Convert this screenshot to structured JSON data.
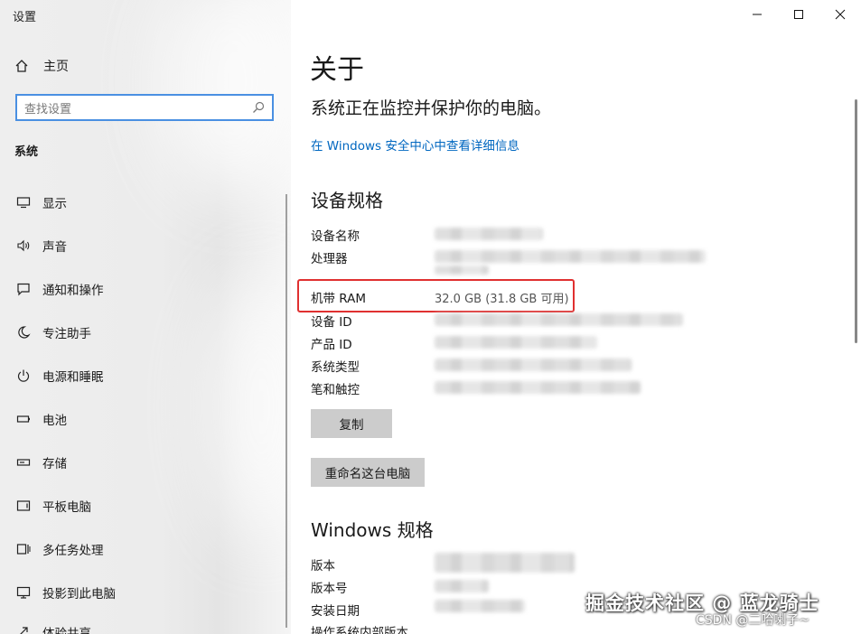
{
  "window": {
    "title": "设置"
  },
  "sidebar": {
    "home_label": "主页",
    "search_placeholder": "查找设置",
    "section_label": "系统",
    "items": [
      {
        "label": "显示",
        "icon": "monitor-icon"
      },
      {
        "label": "声音",
        "icon": "speaker-icon"
      },
      {
        "label": "通知和操作",
        "icon": "notification-icon"
      },
      {
        "label": "专注助手",
        "icon": "moon-icon"
      },
      {
        "label": "电源和睡眠",
        "icon": "power-icon"
      },
      {
        "label": "电池",
        "icon": "battery-icon"
      },
      {
        "label": "存储",
        "icon": "storage-icon"
      },
      {
        "label": "平板电脑",
        "icon": "tablet-icon"
      },
      {
        "label": "多任务处理",
        "icon": "multitask-icon"
      },
      {
        "label": "投影到此电脑",
        "icon": "project-icon"
      },
      {
        "label": "体验共享",
        "icon": "share-icon"
      }
    ]
  },
  "main": {
    "title": "关于",
    "protection_text": "系统正在监控并保护你的电脑。",
    "security_link": "在 Windows 安全中心中查看详细信息",
    "device_specs": {
      "heading": "设备规格",
      "rows": [
        {
          "label": "设备名称",
          "value": ""
        },
        {
          "label": "处理器",
          "value": ""
        },
        {
          "label": "机带 RAM",
          "value": "32.0 GB (31.8 GB 可用)"
        },
        {
          "label": "设备 ID",
          "value": ""
        },
        {
          "label": "产品 ID",
          "value": ""
        },
        {
          "label": "系统类型",
          "value": ""
        },
        {
          "label": "笔和触控",
          "value": ""
        }
      ],
      "copy_button": "复制",
      "rename_button": "重命名这台电脑"
    },
    "windows_specs": {
      "heading": "Windows 规格",
      "rows": [
        {
          "label": "版本"
        },
        {
          "label": "版本号"
        },
        {
          "label": "安装日期"
        },
        {
          "label": "操作系统内部版本"
        }
      ]
    }
  },
  "watermark": {
    "line1": "掘金技术社区 @ 蓝龙骑士",
    "line2": "CSDN @二哈喇子~"
  },
  "colors": {
    "accent": "#0067c0",
    "highlight_box": "#e03030",
    "button_bg": "#cccccc",
    "search_border": "#4a90e2"
  }
}
